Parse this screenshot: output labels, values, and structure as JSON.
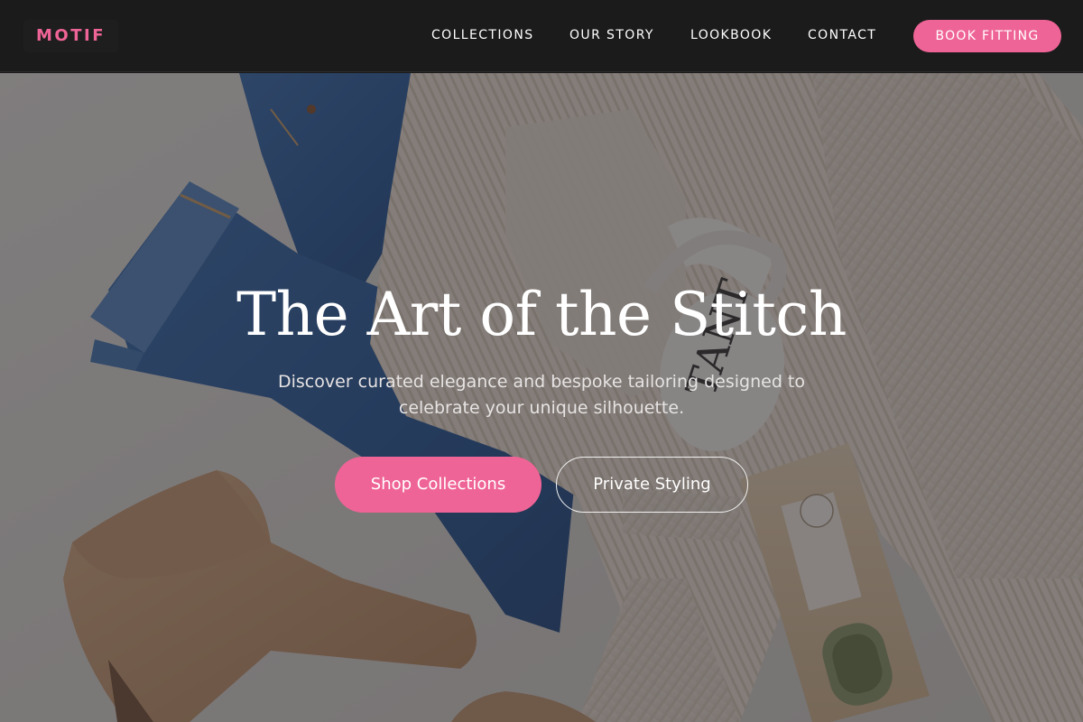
{
  "brand": {
    "name": "MOTIF",
    "accent": "#ef6496"
  },
  "nav": {
    "links": [
      "COLLECTIONS",
      "OUR STORY",
      "LOOKBOOK",
      "CONTACT"
    ],
    "cta_label": "BOOK FITTING"
  },
  "hero": {
    "headline": "The Art of the Stitch",
    "subheadline": "Discover curated elegance and bespoke tailoring designed to celebrate your unique silhouette.",
    "primary_cta": "Shop Collections",
    "secondary_cta": "Private Styling",
    "background_image": "flat-lay-jeans-sweater-mug-boots-tea-bag"
  },
  "colors": {
    "nav_background": "#1b1b1b",
    "overlay": "rgba(28,24,26,0.5)",
    "text_light": "#ffffff"
  }
}
